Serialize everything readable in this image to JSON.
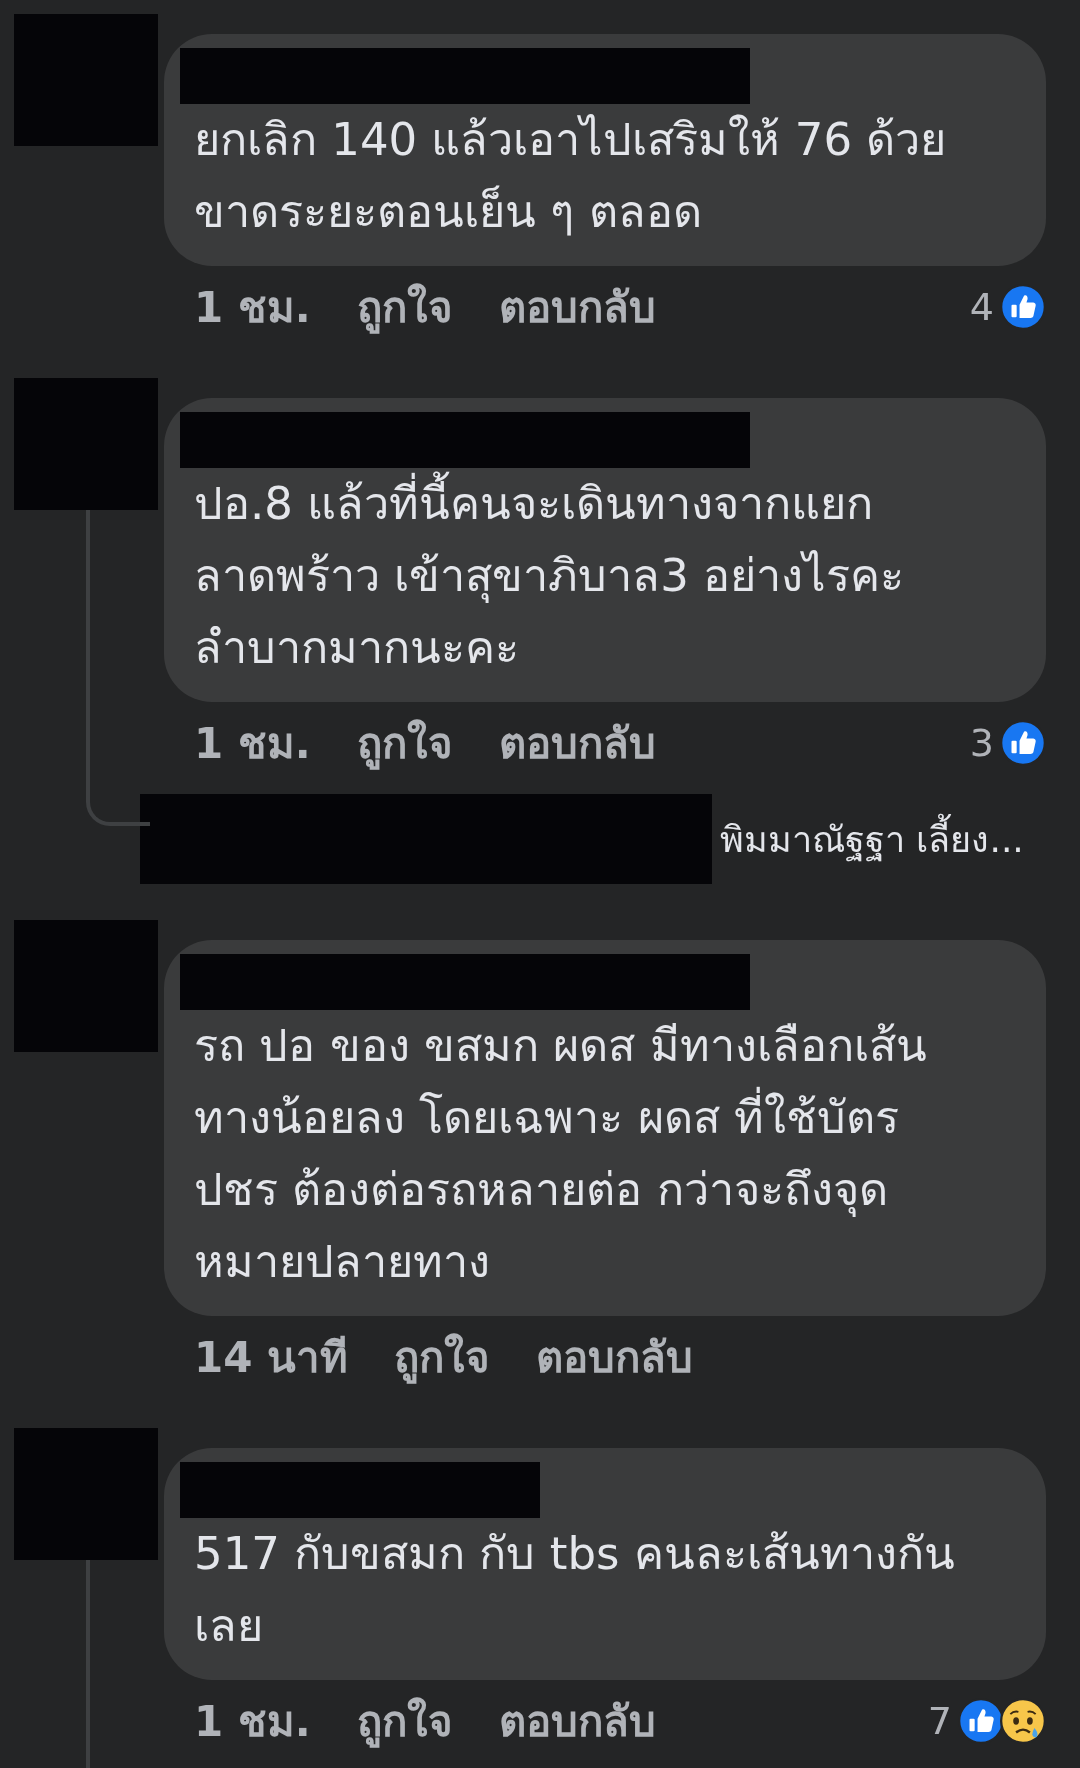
{
  "comments": [
    {
      "text": "ยกเลิก 140 แล้วเอาไปเสริมให้ 76 ด้วย\nขาดระยะตอนเย็น ๆ ตลอด",
      "time": "1 ชม.",
      "like_label": "ถูกใจ",
      "reply_label": "ตอบกลับ",
      "reaction_count": "4",
      "reactions": [
        {
          "kind": "like"
        }
      ],
      "has_replies": false
    },
    {
      "text": "ปอ.8 แล้วที่นี้คนจะเดินทางจากแยก\nลาดพร้าว เข้าสุขาภิบาล3 อย่างไรคะ\nลำบากมากนะคะ",
      "time": "1 ชม.",
      "like_label": "ถูกใจ",
      "reply_label": "ตอบกลับ",
      "reaction_count": "3",
      "reactions": [
        {
          "kind": "like"
        }
      ],
      "has_replies": true,
      "reply_preview": {
        "text": "พิมมาณัฐฐา เลี้ยง..."
      }
    },
    {
      "text": "รถ ปอ ของ ขสมก ผดส มีทางเลือกเส้น\nทางน้อยลง โดยเฉพาะ ผดส ที่ใช้บัตร\nปชร ต้องต่อรถหลายต่อ กว่าจะถึงจุด\nหมายปลายทาง",
      "time": "14 นาที",
      "like_label": "ถูกใจ",
      "reply_label": "ตอบกลับ",
      "has_replies": false
    },
    {
      "text": "517 กับขสมก กับ tbs คนละเส้นทางกัน\nเลย",
      "time": "1 ชม.",
      "like_label": "ถูกใจ",
      "reply_label": "ตอบกลับ",
      "reaction_count": "7",
      "reactions": [
        {
          "kind": "like"
        },
        {
          "kind": "sad"
        }
      ],
      "has_replies": true
    }
  ]
}
